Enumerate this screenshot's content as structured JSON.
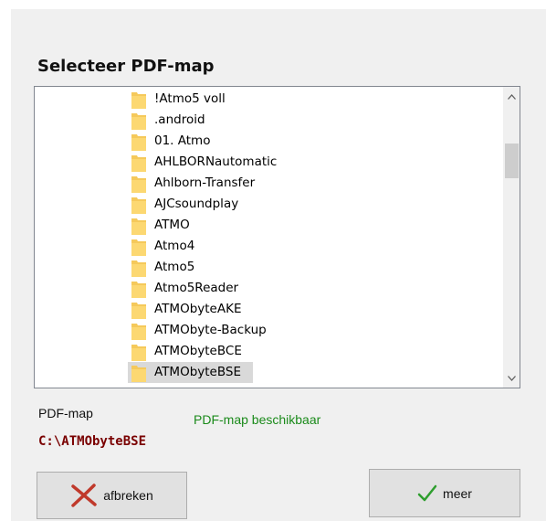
{
  "dialog": {
    "title": "Selecteer PDF-map"
  },
  "tree": {
    "items": [
      {
        "label": "!Atmo5 voll"
      },
      {
        "label": ".android"
      },
      {
        "label": "01. Atmo"
      },
      {
        "label": "AHLBORNautomatic"
      },
      {
        "label": "Ahlborn-Transfer"
      },
      {
        "label": "AJCsoundplay"
      },
      {
        "label": "ATMO"
      },
      {
        "label": "Atmo4"
      },
      {
        "label": "Atmo5"
      },
      {
        "label": "Atmo5Reader"
      },
      {
        "label": "ATMObyteAKE"
      },
      {
        "label": "ATMObyte-Backup"
      },
      {
        "label": "ATMObyteBCE"
      },
      {
        "label": "ATMObyteBSE"
      }
    ],
    "selected_index": 13
  },
  "pdf": {
    "label": "PDF-map",
    "status": "PDF-map beschikbaar",
    "path": "C:\\ATMObyteBSE"
  },
  "buttons": {
    "cancel_label": "afbreken",
    "more_label": "meer"
  },
  "colors": {
    "folder": "#f5c95b",
    "status_green": "#1a8a1a",
    "path_red": "#7a0000",
    "cancel_icon": "#c0392b",
    "check_icon": "#2e9e2e"
  },
  "icons": {
    "folder": "folder-icon",
    "cancel": "close-icon",
    "confirm": "checkmark-icon"
  }
}
